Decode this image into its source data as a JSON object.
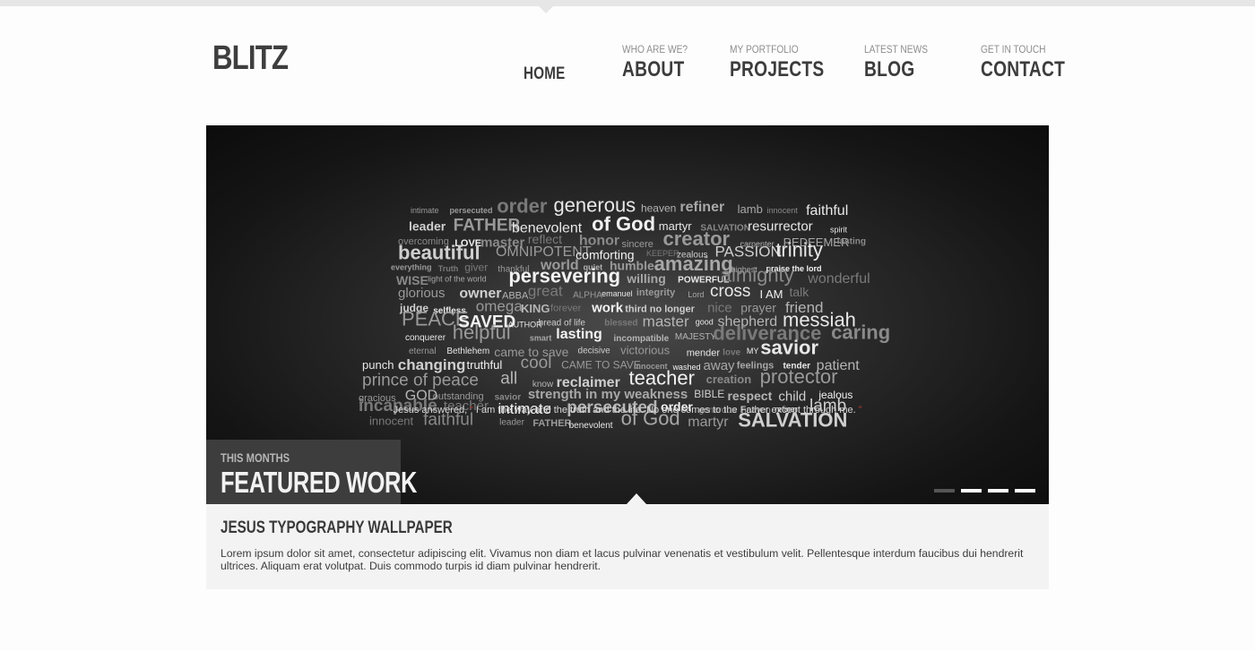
{
  "brand": {
    "logo": "BLITZ"
  },
  "nav": {
    "items": [
      {
        "sub": "",
        "label": "HOME"
      },
      {
        "sub": "WHO ARE WE?",
        "label": "ABOUT"
      },
      {
        "sub": "MY PORTFOLIO",
        "label": "PROJECTS"
      },
      {
        "sub": "LATEST NEWS",
        "label": "BLOG"
      },
      {
        "sub": "GET IN TOUCH",
        "label": "CONTACT"
      }
    ]
  },
  "slider": {
    "word_cloud": [
      "intimate",
      "persecuted",
      "order",
      "generous",
      "heaven",
      "refiner",
      "lamb",
      "innocent",
      "faithful",
      "leader",
      "FATHER",
      "benevolent",
      "of God",
      "martyr",
      "SALVATION",
      "resurrector",
      "spirit",
      "overcoming",
      "LOVE",
      "master",
      "reflect",
      "honor",
      "sincere",
      "creator",
      "carpenter",
      "REDEEMER",
      "lasting",
      "beautiful",
      "OMNIPOTENT",
      "comforting",
      "KEEPER",
      "zealous",
      "PASSION",
      "trinity",
      "everything",
      "Truth",
      "giver",
      "thankful",
      "world",
      "quiet",
      "humble",
      "amazing",
      "highest",
      "praise the lord",
      "WISE",
      "light of the world",
      "persevering",
      "willing",
      "POWERFUL",
      "almighty",
      "wonderful",
      "glorious",
      "owner",
      "ABBA",
      "great",
      "ALPHA",
      "emanuel",
      "integrity",
      "Lord",
      "cross",
      "I AM",
      "talk",
      "judge",
      "selfless",
      "omega",
      "KING",
      "forever",
      "work",
      "third no longer",
      "nice",
      "prayer",
      "friend",
      "PEACE",
      "SAVED",
      "AUTHOR",
      "bread of life",
      "blessed",
      "master",
      "good",
      "shepherd",
      "messiah",
      "conquerer",
      "helpful",
      "smart",
      "lasting",
      "incompatible",
      "MAJESTY",
      "deliverance",
      "caring",
      "eternal",
      "Bethlehem",
      "came to save",
      "decisive",
      "victorious",
      "mender",
      "love",
      "MY",
      "savior",
      "punch",
      "changing",
      "truthful",
      "cool",
      "CAME TO SAVE",
      "innocent",
      "washed",
      "away",
      "feelings",
      "tender",
      "patient",
      "prince of peace",
      "all",
      "know",
      "reclaimer",
      "teacher",
      "creation",
      "protector",
      "gracious",
      "GOD",
      "outstanding",
      "savior",
      "strength in my weakness",
      "BIBLE",
      "respect",
      "child",
      "jealous",
      "incapable",
      "teacher"
    ],
    "quote": {
      "prefix": "Jesus answered,",
      "open_mark": "“",
      "body": "I am the way and the truth and the life. No one comes to the Father except through me.",
      "close_mark": "”"
    },
    "featured_small": "THIS MONTHS",
    "featured_big": "FEATURED WORK",
    "pager": {
      "count": 4,
      "active_index": 0
    }
  },
  "caption": {
    "title": "JESUS TYPOGRAPHY WALLPAPER",
    "text": "Lorem ipsum dolor sit amet, consectetur adipiscing elit. Vivamus non diam et lacus pulvinar venenatis et vestibulum velit. Pellentesque interdum faucibus dui hendrerit ultrices. Aliquam erat volutpat. Duis commodo turpis id diam pulvinar hendrerit."
  },
  "colors": {
    "accent_red": "#c0392b",
    "slider_dark": "#151515",
    "featured_box": "#3d3d3d",
    "caption_bg": "#f3f3f3"
  }
}
